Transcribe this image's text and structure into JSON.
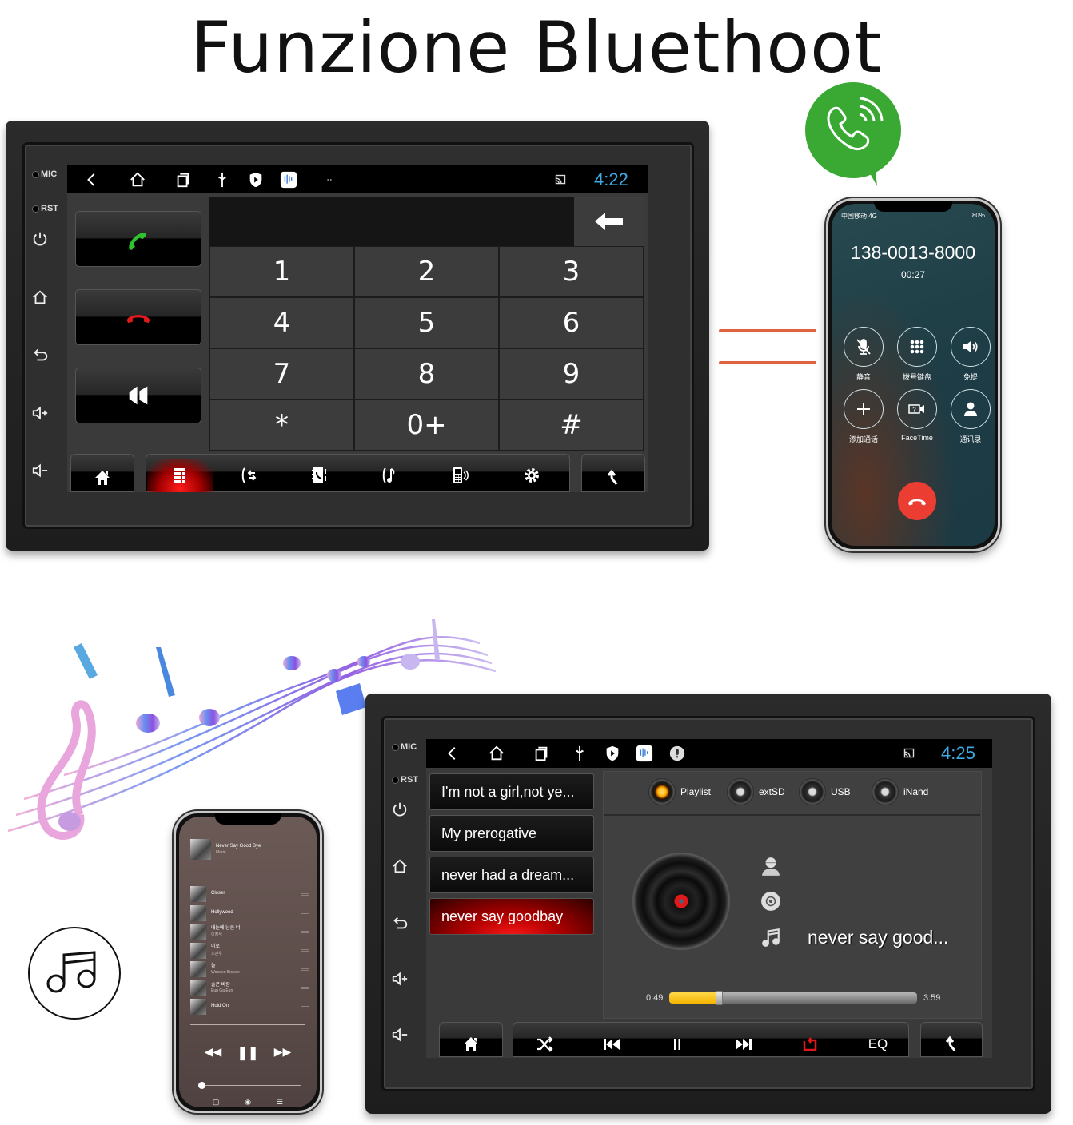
{
  "title": "Funzione Bluethoot",
  "colors": {
    "clock": "#3fa9e0",
    "accent_red": "#e01a1a",
    "call_green": "#2ec22e",
    "end_call_red": "#ec3d32",
    "progress_yellow": "#f4b400",
    "equals_orange": "#e2623d",
    "bubble_green": "#3aa934"
  },
  "top_unit": {
    "side_labels": [
      "MIC",
      "RST"
    ],
    "side_icons": [
      "power-icon",
      "home-icon",
      "back-icon",
      "volume-up-icon",
      "volume-down-icon"
    ],
    "status_bar": {
      "icons": [
        "back-chevron-icon",
        "home-icon",
        "recents-icon",
        "usb-icon",
        "shield-play-icon",
        "radio-app-icon",
        "more-dots-icon",
        "cast-icon"
      ],
      "clock": "4:22"
    },
    "call_buttons": [
      "answer-call-icon",
      "hang-up-icon",
      "speaker-icon"
    ],
    "dial_display_value": "",
    "keypad": [
      "1",
      "2",
      "3",
      "4",
      "5",
      "6",
      "7",
      "8",
      "9",
      "*",
      "0+",
      "#"
    ],
    "dock": {
      "home": "home-icon",
      "items": [
        "dialpad-icon",
        "call-transfer-icon",
        "contacts-icon",
        "call-music-icon",
        "phone-link-icon",
        "settings-icon"
      ],
      "active_index": 0,
      "back": "return-icon"
    }
  },
  "call_phone": {
    "status_left": "中国移动 4G",
    "status_right": "80%",
    "number": "138-0013-8000",
    "timer": "00:27",
    "buttons": [
      {
        "icon": "mute-icon",
        "label": "静音"
      },
      {
        "icon": "keypad-icon",
        "label": "拨号键盘"
      },
      {
        "icon": "speaker-icon",
        "label": "免提"
      },
      {
        "icon": "add-call-icon",
        "label": "添加通话"
      },
      {
        "icon": "facetime-icon",
        "label": "FaceTime"
      },
      {
        "icon": "contacts-icon",
        "label": "通讯录"
      }
    ]
  },
  "bottom_unit": {
    "side_labels": [
      "MIC",
      "RST"
    ],
    "status_bar": {
      "icons": [
        "back-chevron-icon",
        "home-icon",
        "recents-icon",
        "usb-icon",
        "shield-play-icon",
        "radio-app-icon",
        "mic-icon",
        "cast-icon"
      ],
      "clock": "4:25"
    },
    "tracks": [
      {
        "label": "I'm not a girl,not ye...",
        "active": false
      },
      {
        "label": "My prerogative",
        "active": false
      },
      {
        "label": "never had a dream...",
        "active": false
      },
      {
        "label": "never say goodbay",
        "active": true
      }
    ],
    "sources": [
      {
        "label": "Playlist",
        "active": true
      },
      {
        "label": "extSD",
        "active": false
      },
      {
        "label": "USB",
        "active": false
      },
      {
        "label": "iNand",
        "active": false
      }
    ],
    "now_playing": {
      "artist": "",
      "album": "",
      "title": "never say good...",
      "elapsed": "0:49",
      "total": "3:59",
      "progress": 0.2
    },
    "controls": [
      "shuffle-icon",
      "previous-icon",
      "pause-icon",
      "next-icon",
      "repeat-icon"
    ],
    "eq_label": "EQ"
  },
  "music_phone": {
    "now_playing_title": "Never Say Good Bye",
    "now_playing_artist": "Mario",
    "queue": [
      {
        "title": "Closer",
        "sub": ""
      },
      {
        "title": "Hollywood",
        "sub": ""
      },
      {
        "title": "내눈에 남은 너",
        "sub": "이정석"
      },
      {
        "title": "미로",
        "sub": "조관우"
      },
      {
        "title": "늘",
        "sub": "Wooden Bicycle"
      },
      {
        "title": "슬픈 바람",
        "sub": "Eun Ga Eun"
      },
      {
        "title": "Hold On",
        "sub": ""
      }
    ]
  }
}
